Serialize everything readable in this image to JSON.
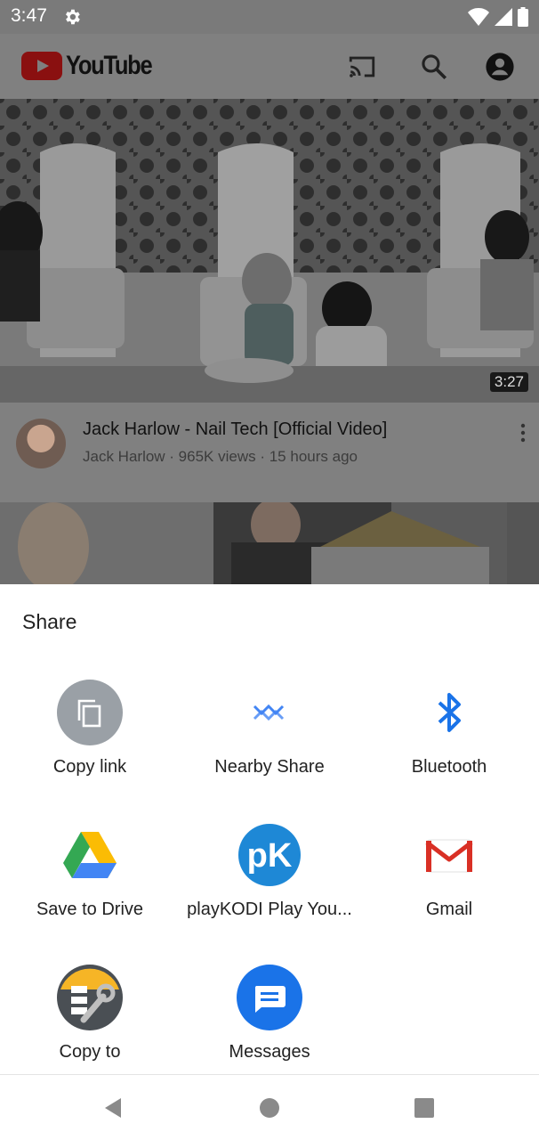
{
  "status_bar": {
    "time": "3:47"
  },
  "app_bar": {
    "logo_text": "YouTube"
  },
  "video": {
    "duration": "3:27",
    "title": "Jack Harlow - Nail Tech [Official Video]",
    "meta": "Jack Harlow · 965K views · 15 hours ago"
  },
  "share_sheet": {
    "title": "Share",
    "targets": [
      {
        "label": "Copy link",
        "icon": "copy-icon"
      },
      {
        "label": "Nearby Share",
        "icon": "nearby-share-icon"
      },
      {
        "label": "Bluetooth",
        "icon": "bluetooth-icon"
      },
      {
        "label": "Save to Drive",
        "icon": "google-drive-icon"
      },
      {
        "label": "playKODI Play You...",
        "icon": "playkodi-icon"
      },
      {
        "label": "Gmail",
        "icon": "gmail-icon"
      },
      {
        "label": "Copy to",
        "icon": "copy-to-icon"
      },
      {
        "label": "Messages",
        "icon": "messages-icon"
      }
    ]
  },
  "colors": {
    "scrim": "#808080",
    "bluetooth": "#1a73e8",
    "messages": "#1a73e8",
    "gmail_red": "#d93025"
  }
}
